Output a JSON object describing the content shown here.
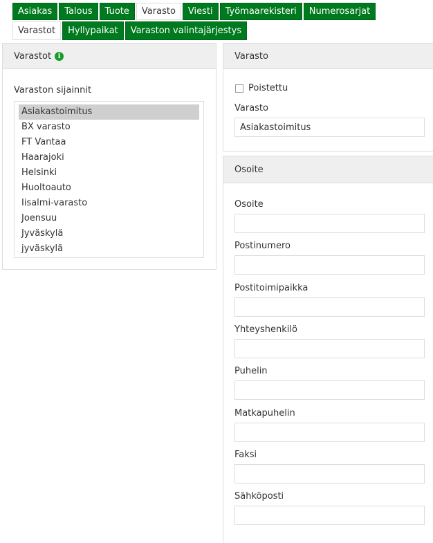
{
  "top_tabs": [
    "Asiakas",
    "Talous",
    "Tuote",
    "Varasto",
    "Viesti",
    "Työmaarekisteri",
    "Numerosarjat"
  ],
  "sub_tabs": [
    "Varastot",
    "Hyllypaikat",
    "Varaston valintajärjestys"
  ],
  "list_panel": {
    "title": "Varastot",
    "info_icon_glyph": "i",
    "list_label": "Varaston sijainnit",
    "items": [
      "Asiakastoimitus",
      "BX varasto",
      "FT Vantaa",
      "Haarajoki",
      "Helsinki",
      "Huoltoauto",
      "Iisalmi-varasto",
      "Joensuu",
      "Jyväskylä",
      "jyväskylä"
    ]
  },
  "warehouse_panel": {
    "title": "Varasto",
    "deleted_label": "Poistettu",
    "deleted_checked": false,
    "name_label": "Varasto",
    "name_value": "Asiakastoimitus"
  },
  "address_panel": {
    "title": "Osoite",
    "fields": [
      {
        "label": "Osoite",
        "value": ""
      },
      {
        "label": "Postinumero",
        "value": ""
      },
      {
        "label": "Postitoimipaikka",
        "value": ""
      },
      {
        "label": "Yhteyshenkilö",
        "value": ""
      },
      {
        "label": "Puhelin",
        "value": ""
      },
      {
        "label": "Matkapuhelin",
        "value": ""
      },
      {
        "label": "Faksi",
        "value": ""
      },
      {
        "label": "Sähköposti",
        "value": ""
      }
    ]
  },
  "colors": {
    "tab_green": "#007a1e",
    "info_green": "#1a9c2a",
    "selected_item": "#cfcfcf"
  }
}
